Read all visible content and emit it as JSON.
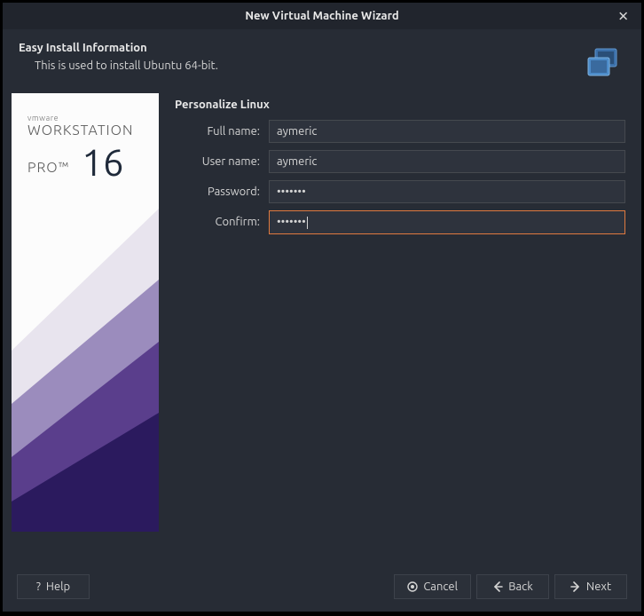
{
  "titlebar": {
    "title": "New Virtual Machine Wizard"
  },
  "header": {
    "title": "Easy Install Information",
    "subtitle": "This is used to install Ubuntu 64-bit."
  },
  "sidebar": {
    "brand_small": "vmware",
    "brand_line1": "WORKSTATION",
    "brand_line2": "PRO™",
    "version": "16"
  },
  "form": {
    "section_title": "Personalize Linux",
    "fullname_label": "Full name:",
    "fullname_value": "aymeric",
    "username_label": "User name:",
    "username_value": "aymeric",
    "password_label": "Password:",
    "password_value": "•••••••",
    "confirm_label": "Confirm:",
    "confirm_value": "•••••••"
  },
  "footer": {
    "help_label": "Help",
    "cancel_label": "Cancel",
    "back_label": "Back",
    "next_label": "Next"
  }
}
